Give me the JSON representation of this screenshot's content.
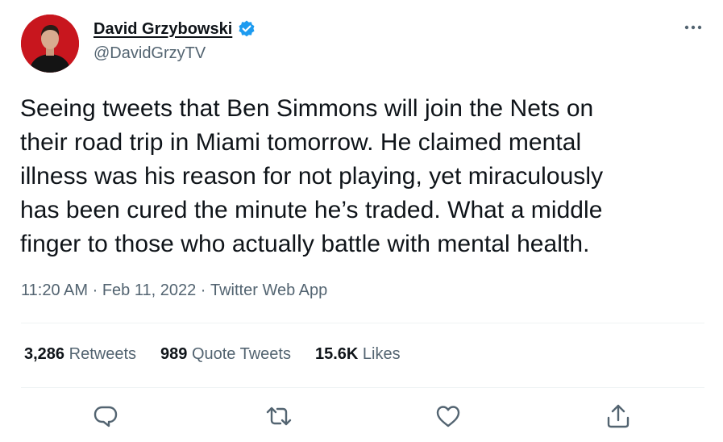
{
  "author": {
    "display_name": "David Grzybowski",
    "handle": "@DavidGrzyTV",
    "verified_icon": "verified-badge-icon",
    "badge_color": "#1d9bf0"
  },
  "tweet": {
    "lines": [
      "Seeing tweets that Ben Simmons will join the Nets on",
      "their road trip in Miami tomorrow. He claimed mental",
      "illness was his reason for not playing, yet miraculously",
      "has been cured the minute he’s traded. What a middle",
      "finger to those who actually battle with mental health."
    ]
  },
  "meta": {
    "time": "11:20 AM",
    "sep1": " · ",
    "date": "Feb 11, 2022",
    "sep2": " · ",
    "source": "Twitter Web App"
  },
  "stats": {
    "retweets_count": "3,286",
    "retweets_label": "Retweets",
    "quotes_count": "989",
    "quotes_label": "Quote Tweets",
    "likes_count": "15.6K",
    "likes_label": "Likes"
  },
  "actions": {
    "reply_icon": "reply-icon",
    "retweet_icon": "retweet-icon",
    "like_icon": "heart-icon",
    "share_icon": "share-icon"
  },
  "colors": {
    "text": "#0f1419",
    "secondary": "#536471",
    "divider": "#eff3f4",
    "avatar_bg": "#c8161e"
  }
}
